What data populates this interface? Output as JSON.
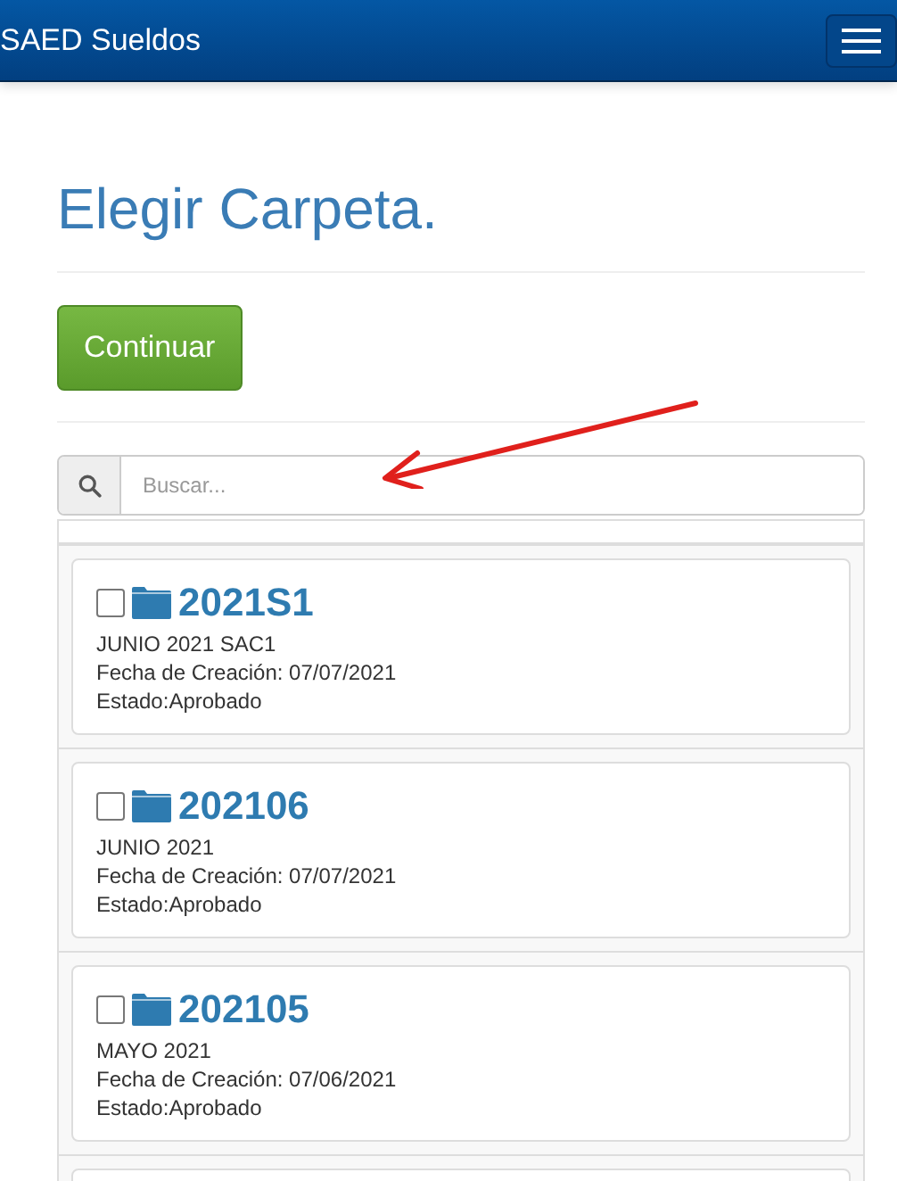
{
  "navbar": {
    "brand": "SAED Sueldos"
  },
  "page": {
    "title": "Elegir Carpeta.",
    "continue_button": "Continuar"
  },
  "search": {
    "placeholder": "Buscar..."
  },
  "folders": [
    {
      "name": "2021S1",
      "description": "JUNIO 2021 SAC1",
      "created": "Fecha de Creación: 07/07/2021",
      "status": "Estado:Aprobado",
      "checked": false
    },
    {
      "name": "202106",
      "description": "JUNIO 2021",
      "created": "Fecha de Creación: 07/07/2021",
      "status": "Estado:Aprobado",
      "checked": false
    },
    {
      "name": "202105",
      "description": "MAYO 2021",
      "created": "Fecha de Creación: 07/06/2021",
      "status": "Estado:Aprobado",
      "checked": false
    }
  ]
}
